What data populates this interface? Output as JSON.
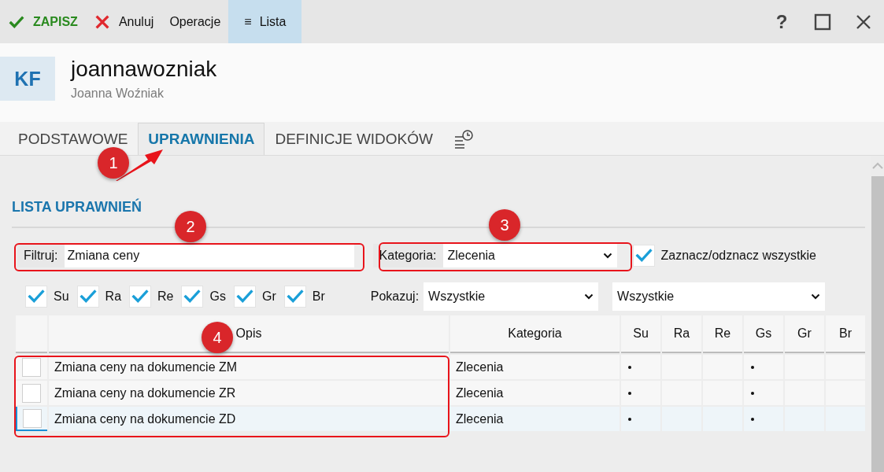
{
  "toolbar": {
    "items": [
      {
        "kind": "save",
        "label": "ZAPISZ",
        "selected": false
      },
      {
        "kind": "cancel",
        "label": "Anuluj",
        "selected": false
      },
      {
        "kind": "plain",
        "label": "Operacje",
        "selected": false
      },
      {
        "kind": "list",
        "icon": "≡",
        "label": "Lista",
        "selected": true
      }
    ],
    "help": "?"
  },
  "header": {
    "avatar": "KF",
    "username": "joannawozniak",
    "full_name": "Joanna Woźniak"
  },
  "tabs": [
    {
      "kind": "text",
      "label": "PODSTAWOWE",
      "selected": false
    },
    {
      "kind": "text",
      "label": "UPRAWNIENIA",
      "selected": true
    },
    {
      "kind": "text",
      "label": "DEFINICJE WIDOKÓW",
      "selected": false
    },
    {
      "kind": "history",
      "selected": false
    }
  ],
  "section_title": "LISTA UPRAWNIEŃ",
  "filter": {
    "label": "Filtruj:",
    "value": "Zmiana ceny"
  },
  "category": {
    "label": "Kategoria:",
    "value": "Zlecenia"
  },
  "select_all": {
    "label": "Zaznacz/odznacz wszystkie",
    "checked": true
  },
  "role_filters": [
    {
      "label": "Su",
      "checked": true
    },
    {
      "label": "Ra",
      "checked": true
    },
    {
      "label": "Re",
      "checked": true
    },
    {
      "label": "Gs",
      "checked": true
    },
    {
      "label": "Gr",
      "checked": true
    },
    {
      "label": "Br",
      "checked": true
    }
  ],
  "show": {
    "label": "Pokazuj:",
    "value": "Wszystkie",
    "value_2": "Wszystkie"
  },
  "table": {
    "columns": [
      "Opis",
      "Kategoria",
      "Su",
      "Ra",
      "Re",
      "Gs",
      "Gr",
      "Br"
    ],
    "rows": [
      {
        "checked": false,
        "selected": false,
        "opis": "Zmiana ceny na dokumencie ZM",
        "kategoria": "Zlecenia",
        "flags": [
          true,
          false,
          false,
          true,
          false,
          false
        ]
      },
      {
        "checked": false,
        "selected": false,
        "opis": "Zmiana ceny na dokumencie ZR",
        "kategoria": "Zlecenia",
        "flags": [
          true,
          false,
          false,
          true,
          false,
          false
        ]
      },
      {
        "checked": false,
        "selected": true,
        "opis": "Zmiana ceny na dokumencie ZD",
        "kategoria": "Zlecenia",
        "flags": [
          true,
          false,
          false,
          true,
          false,
          false
        ]
      }
    ]
  },
  "callouts": [
    {
      "number": "1"
    },
    {
      "number": "2"
    },
    {
      "number": "3"
    },
    {
      "number": "4"
    }
  ]
}
